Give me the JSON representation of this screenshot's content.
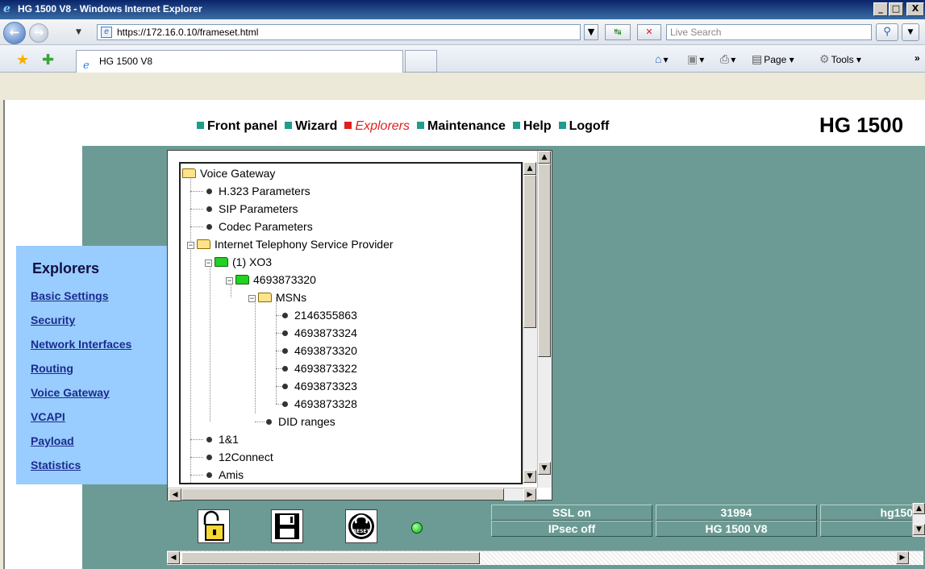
{
  "window": {
    "title": "HG 1500 V8 - Windows Internet Explorer",
    "min_label": "_",
    "max_label": "□",
    "close_label": "X"
  },
  "address": {
    "url": "https://172.16.0.10/frameset.html",
    "search_placeholder": "Live Search"
  },
  "tabs": {
    "active_label": "HG 1500 V8"
  },
  "commands": {
    "page": "Page",
    "tools": "Tools"
  },
  "menu": {
    "items": [
      {
        "label": "Front panel",
        "color": "#1f9c8c"
      },
      {
        "label": "Wizard",
        "color": "#1f9c8c"
      },
      {
        "label": "Explorers",
        "color": "#e02020",
        "active": true
      },
      {
        "label": "Maintenance",
        "color": "#1f9c8c"
      },
      {
        "label": "Help",
        "color": "#1f9c8c"
      },
      {
        "label": "Logoff",
        "color": "#1f9c8c"
      }
    ],
    "brand": "HG 1500"
  },
  "sidebar": {
    "heading": "Explorers",
    "links": [
      "Basic Settings",
      "Security",
      "Network Interfaces",
      "Routing",
      "Voice Gateway",
      "VCAPI",
      "Payload",
      "Statistics"
    ]
  },
  "tree": {
    "root": "Voice Gateway",
    "h323": "H.323 Parameters",
    "sip": "SIP Parameters",
    "codec": "Codec Parameters",
    "itsp": "Internet Telephony Service Provider",
    "provider": "(1) XO3",
    "account": "4693873320",
    "msns": "MSNs",
    "msn_items": [
      "2146355863",
      "4693873324",
      "4693873320",
      "4693873322",
      "4693873323",
      "4693873328"
    ],
    "did": "DID ranges",
    "providers": [
      "1&1",
      "12Connect",
      "Amis"
    ]
  },
  "status": {
    "ssl": "SSL on",
    "ipsec": "IPsec off",
    "port": "31994",
    "model": "HG 1500 V8",
    "host": "hg150"
  },
  "toolbar": {
    "reset_label": "RESET"
  }
}
